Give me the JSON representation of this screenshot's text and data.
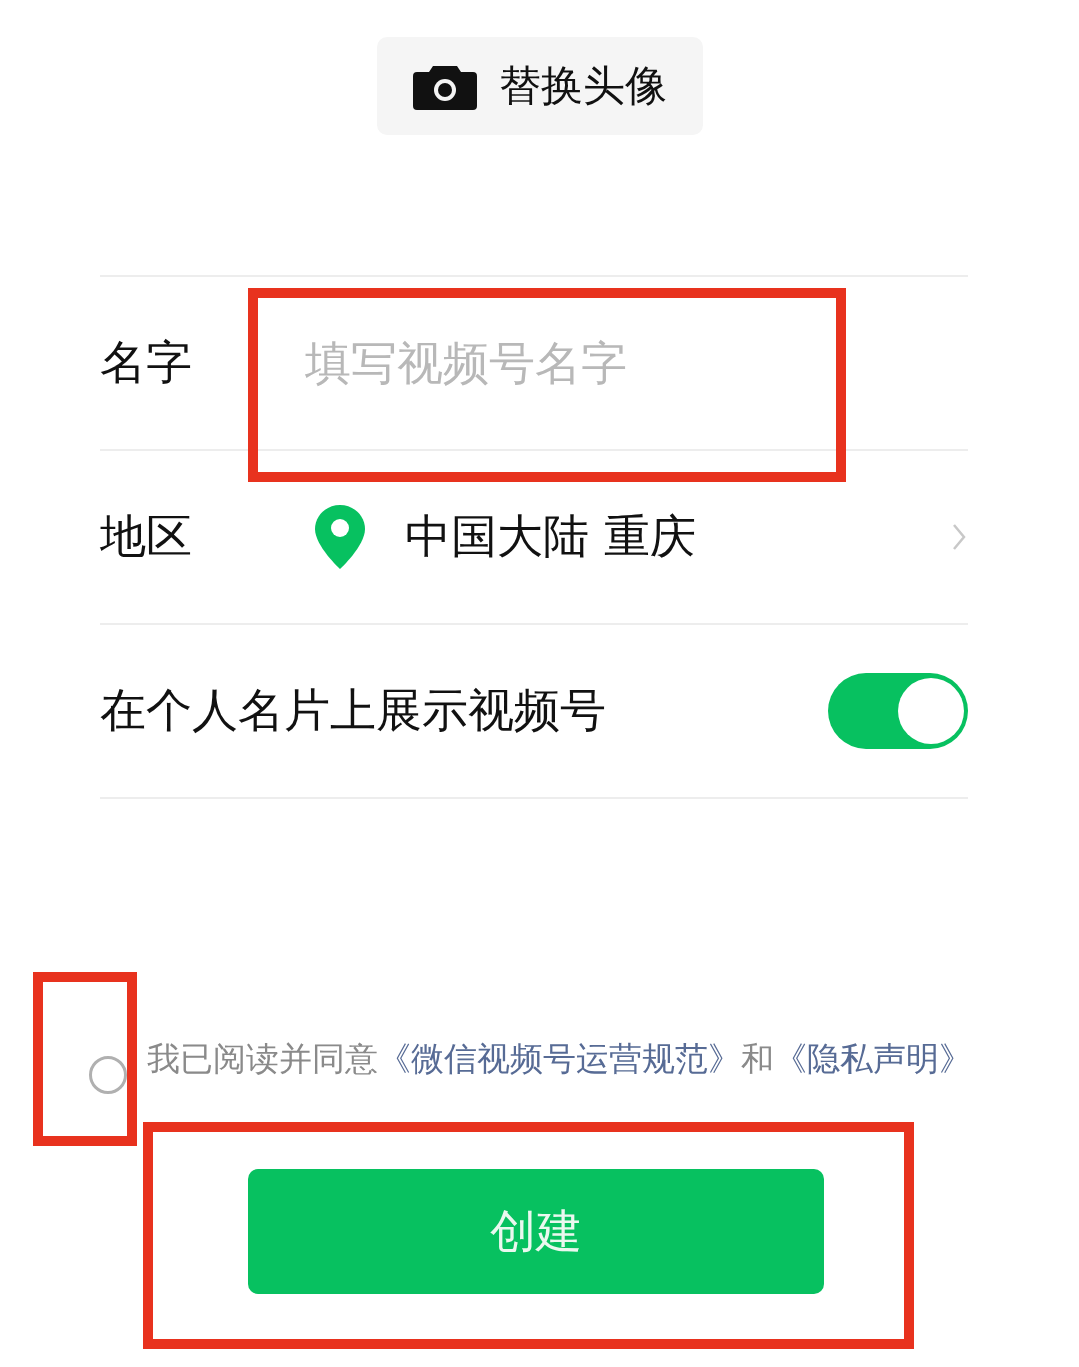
{
  "avatar_button": {
    "label": "替换头像"
  },
  "rows": [
    {
      "kind": "input",
      "label": "名字",
      "placeholder": "填写视频号名字"
    },
    {
      "kind": "location",
      "label": "地区",
      "value": "中国大陆 重庆"
    },
    {
      "kind": "toggle",
      "label": "在个人名片上展示视频号",
      "on": true
    }
  ],
  "agreement": {
    "checked": false,
    "segments": [
      {
        "kind": "text",
        "text": "我已阅读并同意"
      },
      {
        "kind": "link",
        "text": "《微信视频号运营规范》"
      },
      {
        "kind": "text",
        "text": "和"
      },
      {
        "kind": "link",
        "text": "《隐私声明》"
      }
    ]
  },
  "create_button": {
    "label": "创建"
  },
  "annotations": [
    {
      "kind": "name"
    },
    {
      "kind": "checkbox"
    },
    {
      "kind": "create"
    }
  ]
}
